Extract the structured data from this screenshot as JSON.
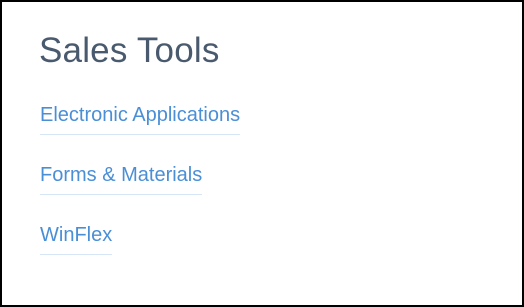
{
  "panel": {
    "title": "Sales Tools",
    "links": [
      {
        "label": "Electronic Applications"
      },
      {
        "label": "Forms & Materials"
      },
      {
        "label": "WinFlex"
      }
    ]
  },
  "colors": {
    "title": "#4a5a6e",
    "link": "#4a8fd6",
    "link_underline": "#d6e6f7",
    "border": "#000000",
    "background": "#ffffff"
  }
}
